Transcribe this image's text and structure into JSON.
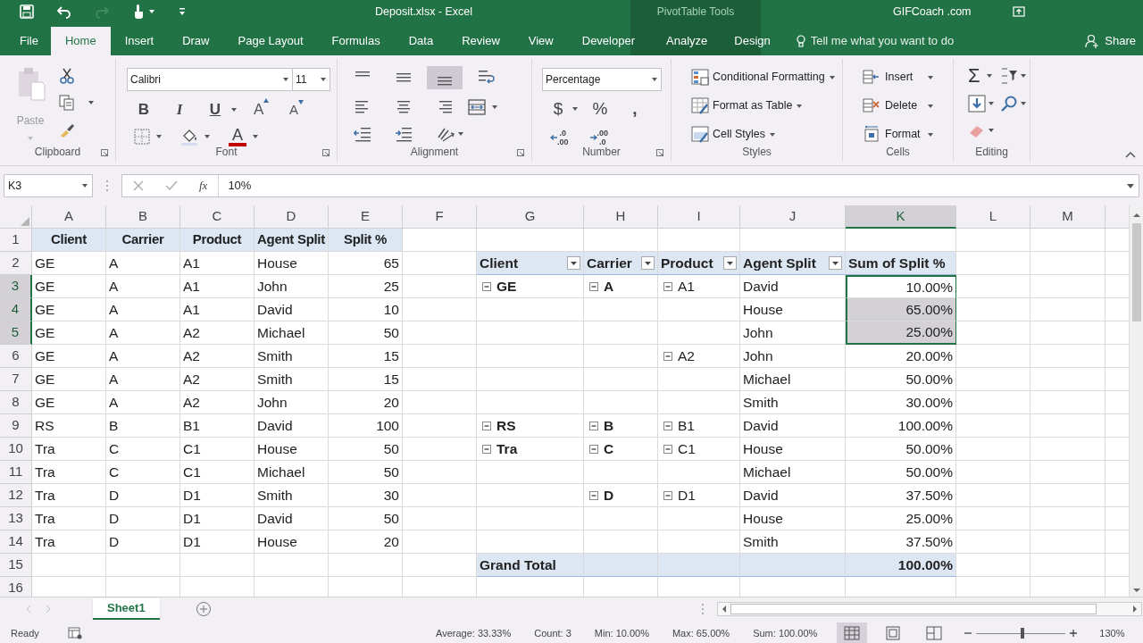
{
  "title_bar": {
    "file_title": "Deposit.xlsx  -  Excel",
    "context_title": "PivotTable Tools",
    "user": "GIFCoach .com"
  },
  "tabs": [
    {
      "label": "File",
      "selected": false,
      "kind": "file"
    },
    {
      "label": "Home",
      "selected": true,
      "kind": "normal"
    },
    {
      "label": "Insert",
      "selected": false,
      "kind": "normal"
    },
    {
      "label": "Draw",
      "selected": false,
      "kind": "normal"
    },
    {
      "label": "Page Layout",
      "selected": false,
      "kind": "normal"
    },
    {
      "label": "Formulas",
      "selected": false,
      "kind": "normal"
    },
    {
      "label": "Data",
      "selected": false,
      "kind": "normal"
    },
    {
      "label": "Review",
      "selected": false,
      "kind": "normal"
    },
    {
      "label": "View",
      "selected": false,
      "kind": "normal"
    },
    {
      "label": "Developer",
      "selected": false,
      "kind": "normal"
    },
    {
      "label": "Analyze",
      "selected": false,
      "kind": "context"
    },
    {
      "label": "Design",
      "selected": false,
      "kind": "context"
    }
  ],
  "tell_me": "Tell me what you want to do",
  "share": "Share",
  "ribbon": {
    "clipboard": {
      "paste": "Paste",
      "label": "Clipboard"
    },
    "font": {
      "name": "Calibri",
      "size": "11",
      "bold": "B",
      "italic": "I",
      "underline": "U",
      "grow": "A",
      "shrink": "A",
      "color_button": "A",
      "label": "Font"
    },
    "alignment": {
      "label": "Alignment",
      "vertical": [
        {
          "selected": false
        },
        {
          "selected": false
        },
        {
          "selected": true
        }
      ]
    },
    "number": {
      "format": "Percentage",
      "currency": "$",
      "percent": "%",
      "comma": ",",
      "decimals": [
        {
          "top": ".0",
          "bottom": ".00"
        },
        {
          "top": ".00",
          "bottom": ".0"
        }
      ],
      "label": "Number"
    },
    "styles": {
      "buttons": [
        "Conditional Formatting",
        "Format as Table",
        "Cell Styles"
      ],
      "label": "Styles"
    },
    "cells": {
      "buttons": [
        "Insert",
        "Delete",
        "Format"
      ],
      "label": "Cells"
    },
    "editing": {
      "sum": "Σ",
      "label": "Editing"
    }
  },
  "formula_bar": {
    "name_box": "K3",
    "fx": "fx",
    "formula": "10%"
  },
  "columns": [
    {
      "label": "A",
      "selected": false
    },
    {
      "label": "B",
      "selected": false
    },
    {
      "label": "C",
      "selected": false
    },
    {
      "label": "D",
      "selected": false
    },
    {
      "label": "E",
      "selected": false
    },
    {
      "label": "F",
      "selected": false
    },
    {
      "label": "G",
      "selected": false
    },
    {
      "label": "H",
      "selected": false
    },
    {
      "label": "I",
      "selected": false
    },
    {
      "label": "J",
      "selected": false
    },
    {
      "label": "K",
      "selected": true
    },
    {
      "label": "L",
      "selected": false
    },
    {
      "label": "M",
      "selected": false
    }
  ],
  "rows": [
    {
      "number": "1",
      "selected": false,
      "pivot_band": false,
      "cells": {
        "A": {
          "text": "Client",
          "kind": "header",
          "selected": false
        },
        "B": {
          "text": "Carrier",
          "kind": "header",
          "selected": false
        },
        "C": {
          "text": "Product",
          "kind": "header",
          "selected": false
        },
        "D": {
          "text": "Agent Split",
          "kind": "header",
          "selected": false
        },
        "E": {
          "text": "Split %",
          "kind": "header",
          "selected": false
        }
      }
    },
    {
      "number": "2",
      "selected": false,
      "pivot_band": true,
      "cells": {
        "A": {
          "text": "GE",
          "kind": "text",
          "selected": false
        },
        "B": {
          "text": "A",
          "kind": "text",
          "selected": false
        },
        "C": {
          "text": "A1",
          "kind": "text",
          "selected": false
        },
        "D": {
          "text": "House",
          "kind": "text",
          "selected": false
        },
        "E": {
          "text": "65",
          "kind": "number",
          "selected": false
        },
        "G": {
          "text": "Client",
          "kind": "pivot_header",
          "filter": true,
          "selected": false
        },
        "H": {
          "text": "Carrier",
          "kind": "pivot_header",
          "filter": true,
          "selected": false
        },
        "I": {
          "text": "Product",
          "kind": "pivot_header",
          "filter": true,
          "selected": false
        },
        "J": {
          "text": "Agent Split",
          "kind": "pivot_header",
          "filter": true,
          "selected": false
        },
        "K": {
          "text": "Sum of Split %",
          "kind": "pivot_header",
          "filter": false,
          "selected": false
        }
      }
    },
    {
      "number": "3",
      "selected": true,
      "pivot_band": false,
      "cells": {
        "A": {
          "text": "GE",
          "kind": "text",
          "selected": false
        },
        "B": {
          "text": "A",
          "kind": "text",
          "selected": false
        },
        "C": {
          "text": "A1",
          "kind": "text",
          "selected": false
        },
        "D": {
          "text": "John",
          "kind": "text",
          "selected": false
        },
        "E": {
          "text": "25",
          "kind": "number",
          "selected": false
        },
        "G": {
          "text": "GE",
          "kind": "pivot_group",
          "selected": false
        },
        "H": {
          "text": "A",
          "kind": "pivot_group",
          "selected": false
        },
        "I": {
          "text": "A1",
          "kind": "pivot_item",
          "selected": false
        },
        "J": {
          "text": "David",
          "kind": "text",
          "selected": false
        },
        "K": {
          "text": "10.00%",
          "kind": "number",
          "selected": true
        }
      }
    },
    {
      "number": "4",
      "selected": true,
      "pivot_band": false,
      "cells": {
        "A": {
          "text": "GE",
          "kind": "text",
          "selected": false
        },
        "B": {
          "text": "A",
          "kind": "text",
          "selected": false
        },
        "C": {
          "text": "A1",
          "kind": "text",
          "selected": false
        },
        "D": {
          "text": "David",
          "kind": "text",
          "selected": false
        },
        "E": {
          "text": "10",
          "kind": "number",
          "selected": false
        },
        "J": {
          "text": "House",
          "kind": "text",
          "selected": false
        },
        "K": {
          "text": "65.00%",
          "kind": "number",
          "selected": true
        }
      }
    },
    {
      "number": "5",
      "selected": true,
      "pivot_band": false,
      "cells": {
        "A": {
          "text": "GE",
          "kind": "text",
          "selected": false
        },
        "B": {
          "text": "A",
          "kind": "text",
          "selected": false
        },
        "C": {
          "text": "A2",
          "kind": "text",
          "selected": false
        },
        "D": {
          "text": "Michael",
          "kind": "text",
          "selected": false
        },
        "E": {
          "text": "50",
          "kind": "number",
          "selected": false
        },
        "J": {
          "text": "John",
          "kind": "text",
          "selected": false
        },
        "K": {
          "text": "25.00%",
          "kind": "number",
          "selected": true
        }
      }
    },
    {
      "number": "6",
      "selected": false,
      "pivot_band": false,
      "cells": {
        "A": {
          "text": "GE",
          "kind": "text",
          "selected": false
        },
        "B": {
          "text": "A",
          "kind": "text",
          "selected": false
        },
        "C": {
          "text": "A2",
          "kind": "text",
          "selected": false
        },
        "D": {
          "text": "Smith",
          "kind": "text",
          "selected": false
        },
        "E": {
          "text": "15",
          "kind": "number",
          "selected": false
        },
        "I": {
          "text": "A2",
          "kind": "pivot_item",
          "selected": false
        },
        "J": {
          "text": "John",
          "kind": "text",
          "selected": false
        },
        "K": {
          "text": "20.00%",
          "kind": "number",
          "selected": false
        }
      }
    },
    {
      "number": "7",
      "selected": false,
      "pivot_band": false,
      "cells": {
        "A": {
          "text": "GE",
          "kind": "text",
          "selected": false
        },
        "B": {
          "text": "A",
          "kind": "text",
          "selected": false
        },
        "C": {
          "text": "A2",
          "kind": "text",
          "selected": false
        },
        "D": {
          "text": "Smith",
          "kind": "text",
          "selected": false
        },
        "E": {
          "text": "15",
          "kind": "number",
          "selected": false
        },
        "J": {
          "text": "Michael",
          "kind": "text",
          "selected": false
        },
        "K": {
          "text": "50.00%",
          "kind": "number",
          "selected": false
        }
      }
    },
    {
      "number": "8",
      "selected": false,
      "pivot_band": false,
      "cells": {
        "A": {
          "text": "GE",
          "kind": "text",
          "selected": false
        },
        "B": {
          "text": "A",
          "kind": "text",
          "selected": false
        },
        "C": {
          "text": "A2",
          "kind": "text",
          "selected": false
        },
        "D": {
          "text": "John",
          "kind": "text",
          "selected": false
        },
        "E": {
          "text": "20",
          "kind": "number",
          "selected": false
        },
        "J": {
          "text": "Smith",
          "kind": "text",
          "selected": false
        },
        "K": {
          "text": "30.00%",
          "kind": "number",
          "selected": false
        }
      }
    },
    {
      "number": "9",
      "selected": false,
      "pivot_band": false,
      "cells": {
        "A": {
          "text": "RS",
          "kind": "text",
          "selected": false
        },
        "B": {
          "text": "B",
          "kind": "text",
          "selected": false
        },
        "C": {
          "text": "B1",
          "kind": "text",
          "selected": false
        },
        "D": {
          "text": "David",
          "kind": "text",
          "selected": false
        },
        "E": {
          "text": "100",
          "kind": "number",
          "selected": false
        },
        "G": {
          "text": "RS",
          "kind": "pivot_group",
          "selected": false
        },
        "H": {
          "text": "B",
          "kind": "pivot_group",
          "selected": false
        },
        "I": {
          "text": "B1",
          "kind": "pivot_item",
          "selected": false
        },
        "J": {
          "text": "David",
          "kind": "text",
          "selected": false
        },
        "K": {
          "text": "100.00%",
          "kind": "number",
          "selected": false
        }
      }
    },
    {
      "number": "10",
      "selected": false,
      "pivot_band": false,
      "cells": {
        "A": {
          "text": "Tra",
          "kind": "text",
          "selected": false
        },
        "B": {
          "text": "C",
          "kind": "text",
          "selected": false
        },
        "C": {
          "text": "C1",
          "kind": "text",
          "selected": false
        },
        "D": {
          "text": "House",
          "kind": "text",
          "selected": false
        },
        "E": {
          "text": "50",
          "kind": "number",
          "selected": false
        },
        "G": {
          "text": "Tra",
          "kind": "pivot_group",
          "selected": false
        },
        "H": {
          "text": "C",
          "kind": "pivot_group",
          "selected": false
        },
        "I": {
          "text": "C1",
          "kind": "pivot_item",
          "selected": false
        },
        "J": {
          "text": "House",
          "kind": "text",
          "selected": false
        },
        "K": {
          "text": "50.00%",
          "kind": "number",
          "selected": false
        }
      }
    },
    {
      "number": "11",
      "selected": false,
      "pivot_band": false,
      "cells": {
        "A": {
          "text": "Tra",
          "kind": "text",
          "selected": false
        },
        "B": {
          "text": "C",
          "kind": "text",
          "selected": false
        },
        "C": {
          "text": "C1",
          "kind": "text",
          "selected": false
        },
        "D": {
          "text": "Michael",
          "kind": "text",
          "selected": false
        },
        "E": {
          "text": "50",
          "kind": "number",
          "selected": false
        },
        "J": {
          "text": "Michael",
          "kind": "text",
          "selected": false
        },
        "K": {
          "text": "50.00%",
          "kind": "number",
          "selected": false
        }
      }
    },
    {
      "number": "12",
      "selected": false,
      "pivot_band": false,
      "cells": {
        "A": {
          "text": "Tra",
          "kind": "text",
          "selected": false
        },
        "B": {
          "text": "D",
          "kind": "text",
          "selected": false
        },
        "C": {
          "text": "D1",
          "kind": "text",
          "selected": false
        },
        "D": {
          "text": "Smith",
          "kind": "text",
          "selected": false
        },
        "E": {
          "text": "30",
          "kind": "number",
          "selected": false
        },
        "H": {
          "text": "D",
          "kind": "pivot_group",
          "selected": false
        },
        "I": {
          "text": "D1",
          "kind": "pivot_item",
          "selected": false
        },
        "J": {
          "text": "David",
          "kind": "text",
          "selected": false
        },
        "K": {
          "text": "37.50%",
          "kind": "number",
          "selected": false
        }
      }
    },
    {
      "number": "13",
      "selected": false,
      "pivot_band": false,
      "cells": {
        "A": {
          "text": "Tra",
          "kind": "text",
          "selected": false
        },
        "B": {
          "text": "D",
          "kind": "text",
          "selected": false
        },
        "C": {
          "text": "D1",
          "kind": "text",
          "selected": false
        },
        "D": {
          "text": "David",
          "kind": "text",
          "selected": false
        },
        "E": {
          "text": "50",
          "kind": "number",
          "selected": false
        },
        "J": {
          "text": "House",
          "kind": "text",
          "selected": false
        },
        "K": {
          "text": "25.00%",
          "kind": "number",
          "selected": false
        }
      }
    },
    {
      "number": "14",
      "selected": false,
      "pivot_band": false,
      "cells": {
        "A": {
          "text": "Tra",
          "kind": "text",
          "selected": false
        },
        "B": {
          "text": "D",
          "kind": "text",
          "selected": false
        },
        "C": {
          "text": "D1",
          "kind": "text",
          "selected": false
        },
        "D": {
          "text": "House",
          "kind": "text",
          "selected": false
        },
        "E": {
          "text": "20",
          "kind": "number",
          "selected": false
        },
        "J": {
          "text": "Smith",
          "kind": "text",
          "selected": false
        },
        "K": {
          "text": "37.50%",
          "kind": "number",
          "selected": false
        }
      }
    },
    {
      "number": "15",
      "selected": false,
      "pivot_band": true,
      "cells": {
        "G": {
          "text": "Grand Total",
          "kind": "total_label",
          "selected": false
        },
        "K": {
          "text": "100.00%",
          "kind": "total_value",
          "selected": false
        }
      }
    },
    {
      "number": "16",
      "selected": false,
      "pivot_band": false,
      "cells": {}
    }
  ],
  "sheet_tabs": [
    {
      "label": "Sheet1",
      "selected": true
    }
  ],
  "status_bar": {
    "mode": "Ready",
    "stats": [
      "Average: 33.33%",
      "Count: 3",
      "Min: 10.00%",
      "Max: 65.00%",
      "Sum: 100.00%"
    ],
    "views": [
      {
        "kind": "normal",
        "selected": true
      },
      {
        "kind": "page_layout",
        "selected": false
      },
      {
        "kind": "page_break",
        "selected": false
      }
    ],
    "zoom": {
      "level": 0.52,
      "reading": "130%"
    }
  }
}
